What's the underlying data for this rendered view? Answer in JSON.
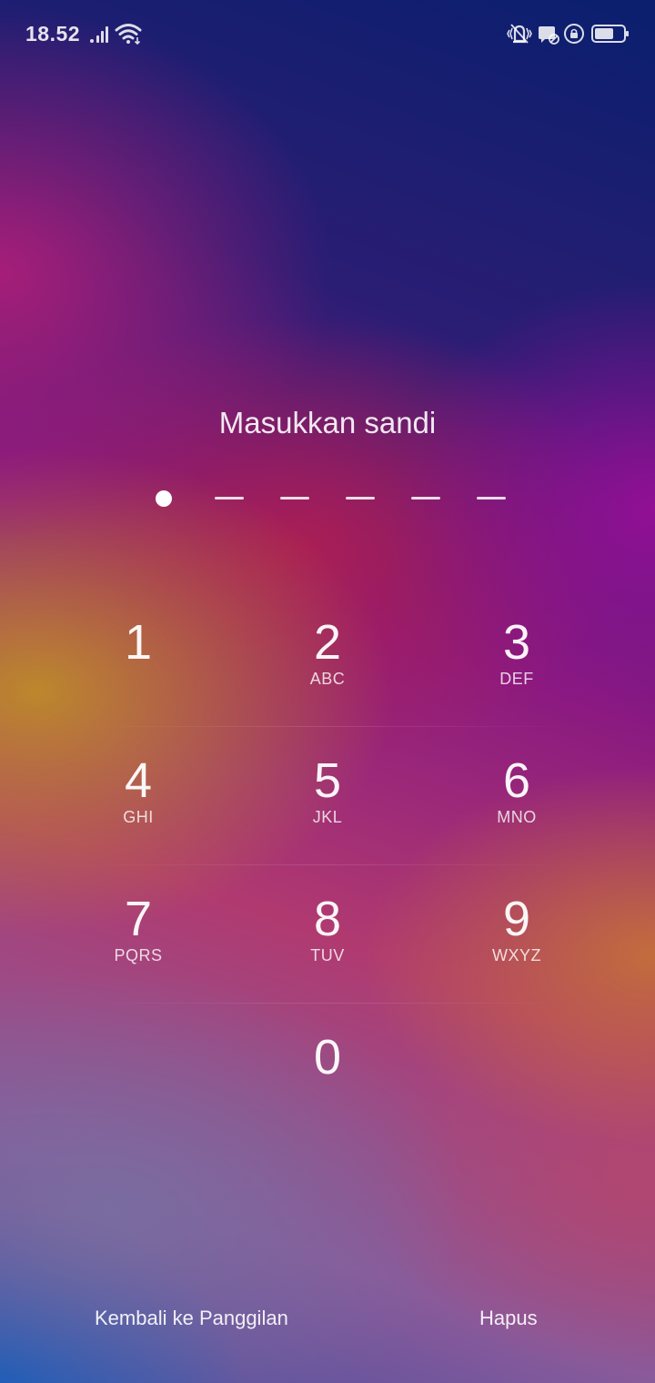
{
  "status_bar": {
    "time": "18.52",
    "icons": [
      "signal-icon",
      "wifi-icon",
      "vibrate-icon",
      "notification-icon",
      "screen-lock-rotation-icon",
      "battery-icon"
    ]
  },
  "lock": {
    "title": "Masukkan sandi",
    "pin_length": 6,
    "pin_entered": 1
  },
  "keypad": {
    "k1": {
      "digit": "1",
      "letters": ""
    },
    "k2": {
      "digit": "2",
      "letters": "ABC"
    },
    "k3": {
      "digit": "3",
      "letters": "DEF"
    },
    "k4": {
      "digit": "4",
      "letters": "GHI"
    },
    "k5": {
      "digit": "5",
      "letters": "JKL"
    },
    "k6": {
      "digit": "6",
      "letters": "MNO"
    },
    "k7": {
      "digit": "7",
      "letters": "PQRS"
    },
    "k8": {
      "digit": "8",
      "letters": "TUV"
    },
    "k9": {
      "digit": "9",
      "letters": "WXYZ"
    },
    "k0": {
      "digit": "0",
      "letters": ""
    }
  },
  "actions": {
    "back_to_call": "Kembali ke Panggilan",
    "delete": "Hapus"
  }
}
